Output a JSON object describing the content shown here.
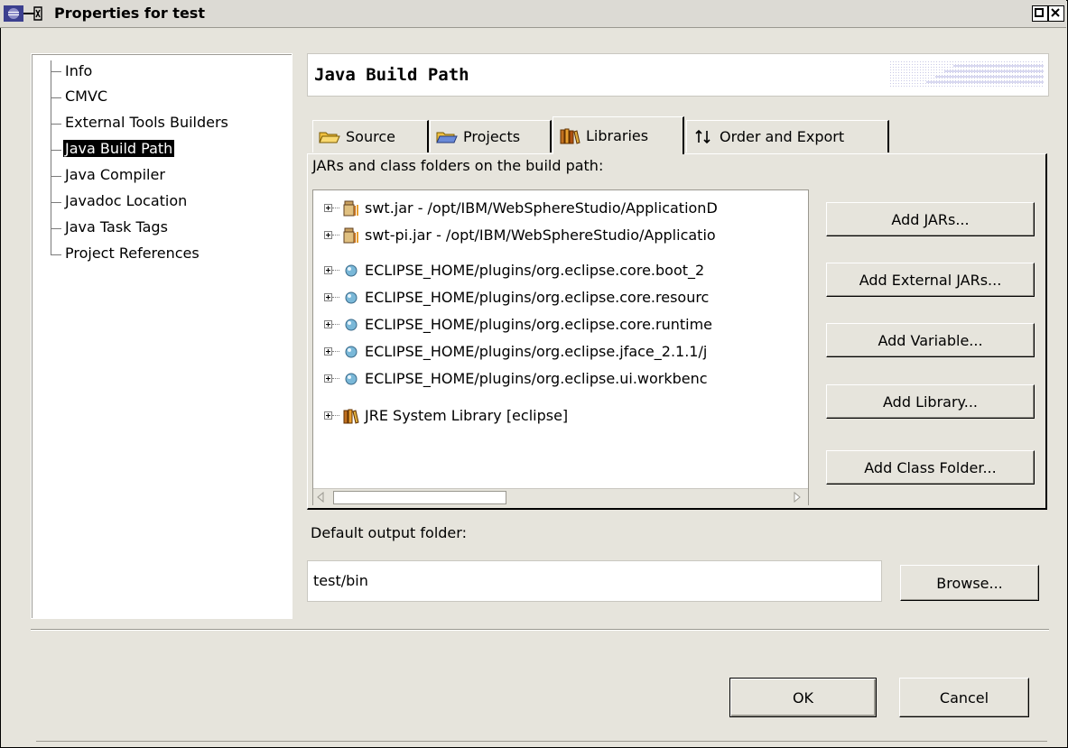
{
  "window": {
    "title": "Properties for test"
  },
  "nav": {
    "items": [
      {
        "label": "Info"
      },
      {
        "label": "CMVC"
      },
      {
        "label": "External Tools Builders"
      },
      {
        "label": "Java Build Path"
      },
      {
        "label": "Java Compiler"
      },
      {
        "label": "Javadoc Location"
      },
      {
        "label": "Java Task Tags"
      },
      {
        "label": "Project References"
      }
    ],
    "selected": "Java Build Path"
  },
  "header": {
    "title": "Java Build Path"
  },
  "tabs": [
    {
      "label": "Source",
      "icon": "folder-open-icon"
    },
    {
      "label": "Projects",
      "icon": "folder-projects-icon"
    },
    {
      "label": "Libraries",
      "icon": "library-icon"
    },
    {
      "label": "Order and Export",
      "icon": "order-arrows-icon"
    }
  ],
  "active_tab": "Libraries",
  "libraries": {
    "caption": "JARs and class folders on the build path:",
    "entries": [
      {
        "label": "swt.jar - /opt/IBM/WebSphereStudio/ApplicationD",
        "icon": "jar-icon"
      },
      {
        "label": "swt-pi.jar - /opt/IBM/WebSphereStudio/Applicatio",
        "icon": "jar-icon"
      },
      {
        "label": "ECLIPSE_HOME/plugins/org.eclipse.core.boot_2",
        "icon": "variable-icon"
      },
      {
        "label": "ECLIPSE_HOME/plugins/org.eclipse.core.resourc",
        "icon": "variable-icon"
      },
      {
        "label": "ECLIPSE_HOME/plugins/org.eclipse.core.runtime",
        "icon": "variable-icon"
      },
      {
        "label": "ECLIPSE_HOME/plugins/org.eclipse.jface_2.1.1/j",
        "icon": "variable-icon"
      },
      {
        "label": "ECLIPSE_HOME/plugins/org.eclipse.ui.workbenc",
        "icon": "variable-icon"
      },
      {
        "label": "JRE System Library [eclipse]",
        "icon": "library-icon"
      }
    ],
    "buttons": {
      "add_jars": "Add JARs...",
      "add_external_jars": "Add External JARs...",
      "add_variable": "Add Variable...",
      "add_library": "Add Library...",
      "add_class_folder": "Add Class Folder..."
    }
  },
  "output": {
    "label": "Default output folder:",
    "value": "test/bin",
    "browse": "Browse..."
  },
  "dialog": {
    "ok": "OK",
    "cancel": "Cancel"
  }
}
